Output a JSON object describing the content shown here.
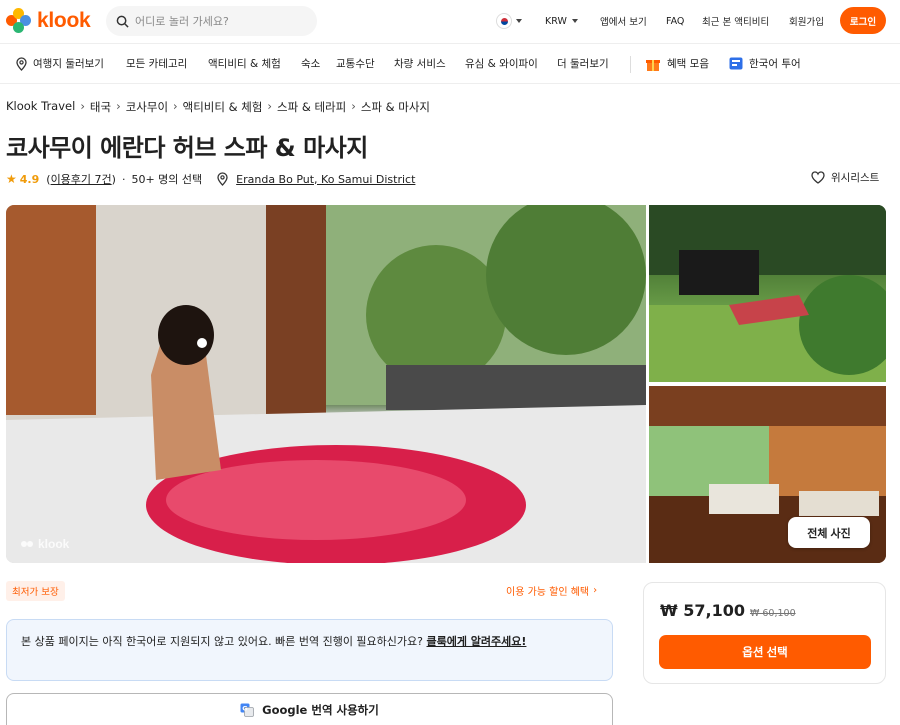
{
  "header": {
    "logo_text": "klook",
    "search_placeholder": "어디로 놀러 가세요?",
    "currency": "KRW",
    "app_label": "앱에서 보기",
    "faq_label": "FAQ",
    "recent_label": "최근 본 액티비티",
    "signup_label": "회원가입",
    "login_label": "로그인"
  },
  "categories": {
    "items": [
      "여행지 둘러보기",
      "모든 카테고리",
      "액티비티 & 체험",
      "숙소",
      "교통수단",
      "차량 서비스",
      "유심 & 와이파이",
      "더 둘러보기"
    ],
    "promo": "혜택 모음",
    "korean_tour": "한국어 투어"
  },
  "breadcrumb": [
    "Klook Travel",
    "태국",
    "코사무이",
    "액티비티 & 체험",
    "스파 & 테라피",
    "스파 & 마사지"
  ],
  "product": {
    "title": "코사무이 에란다 허브 스파 & 마사지",
    "rating": "4.9",
    "reviews": "이용후기 7건",
    "booked": "50+ 명의 선택",
    "location": "Eranda Bo Put, Ko Samui District",
    "wishlist": "위시리스트"
  },
  "gallery": {
    "watermark": "klook",
    "all_photos": "전체 사진"
  },
  "info": {
    "best_price": "최저가 보장",
    "discount": "이용 가능 할인 혜택",
    "notice_text": "본 상품 페이지는 아직 한국어로 지원되지 않고 있어요. 빠른 번역 진행이 필요하신가요? ",
    "notice_link": "클룩에게 알려주세요!",
    "translate_button": "Google 번역 사용하기"
  },
  "pricing": {
    "price": "₩ 57,100",
    "old_price": "₩ 60,100",
    "select_button": "옵션 선택"
  },
  "colors": {
    "brand": "#ff5b00",
    "star": "#f09b0a"
  }
}
